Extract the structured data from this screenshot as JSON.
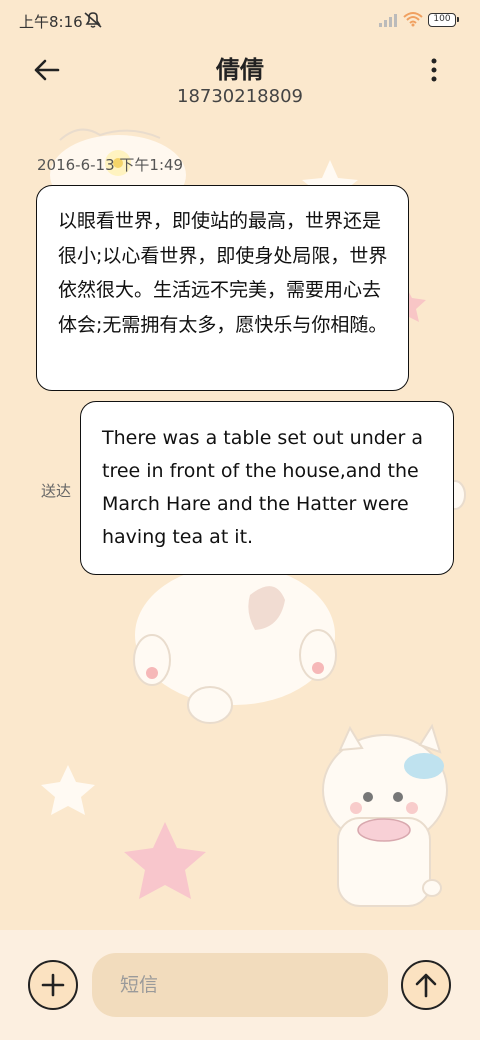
{
  "status_bar": {
    "time": "上午8:16",
    "battery": "100"
  },
  "header": {
    "contact_name": "倩倩",
    "phone_number": "18730218809"
  },
  "messages": [
    {
      "direction": "incoming",
      "timestamp": "2016-6-13 下午1:49",
      "text": "以眼看世界，即使站的最高，世界还是很小;以心看世界，即使身处局限，世界依然很大。生活远不完美，需要用心去体会;无需拥有太多，愿快乐与你相随。"
    },
    {
      "direction": "outgoing",
      "status": "送达",
      "text": "There was a table set out under a tree in front of the house,and the March Hare and the Hatter were having tea at it."
    }
  ],
  "composer": {
    "placeholder": "短信"
  },
  "colors": {
    "background": "#fbe8cd",
    "bubble": "#ffffff",
    "composer_bar": "#fcefe0",
    "input_field": "#f2dcbd"
  },
  "icons": {
    "back": "arrow-left-icon",
    "more": "more-vertical-icon",
    "add": "plus-icon",
    "send": "arrow-up-icon"
  }
}
